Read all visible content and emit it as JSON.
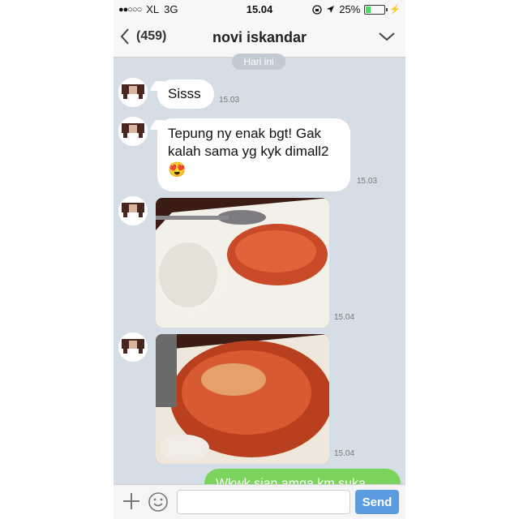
{
  "status_bar": {
    "carrier": "XL",
    "network": "3G",
    "time": "15.04",
    "battery": "25%",
    "battery_level": 0.25
  },
  "nav": {
    "back_count": "(459)",
    "title": "novi iskandar"
  },
  "date_separator": "Hari ini",
  "messages": [
    {
      "text": "Sisss",
      "time": "15.03"
    },
    {
      "text_line1": "Tepung ny enak bgt! Gak",
      "text_line2": "kalah sama yg kyk dimall2",
      "emoji": "😍",
      "time": "15.03"
    },
    {
      "type": "photo",
      "time": "15.04"
    },
    {
      "type": "photo",
      "time": "15.04"
    }
  ],
  "sent_message": "Wkwk sian amga km suka",
  "input": {
    "value": "",
    "send_label": "Send"
  }
}
